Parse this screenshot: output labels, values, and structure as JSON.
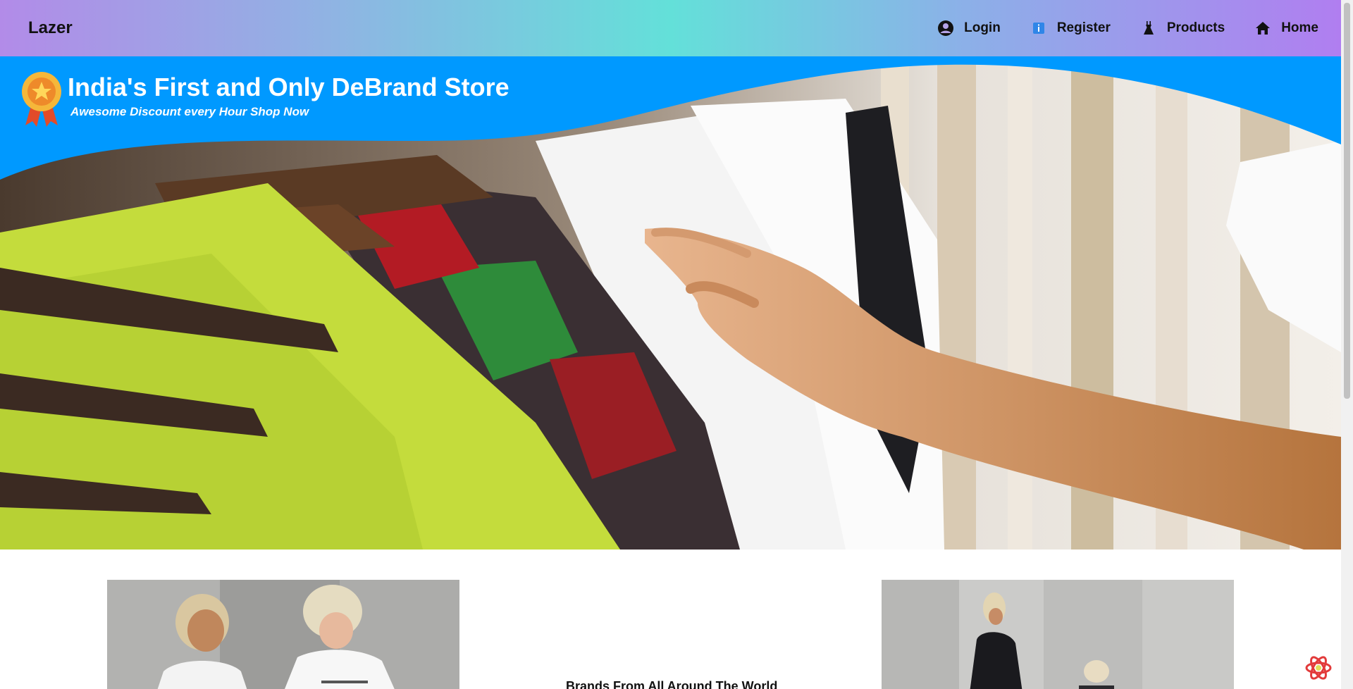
{
  "navbar": {
    "brand": "Lazer",
    "links": [
      {
        "label": "Login",
        "icon": "user-circle-icon"
      },
      {
        "label": "Register",
        "icon": "info-icon"
      },
      {
        "label": "Products",
        "icon": "dress-icon"
      },
      {
        "label": "Home",
        "icon": "home-icon"
      }
    ]
  },
  "hero": {
    "title": "India's First and Only DeBrand Store",
    "subtitle": "Awesome Discount every Hour Shop Now",
    "badge_icon": "award-ribbon-icon"
  },
  "section": {
    "heading": "Brands From All Around The World"
  },
  "colors": {
    "hero_banner": "#0099ff",
    "nav_gradient_start": "#b28be8",
    "nav_gradient_mid": "#63e0d9",
    "nav_gradient_end": "#b07ef0"
  }
}
